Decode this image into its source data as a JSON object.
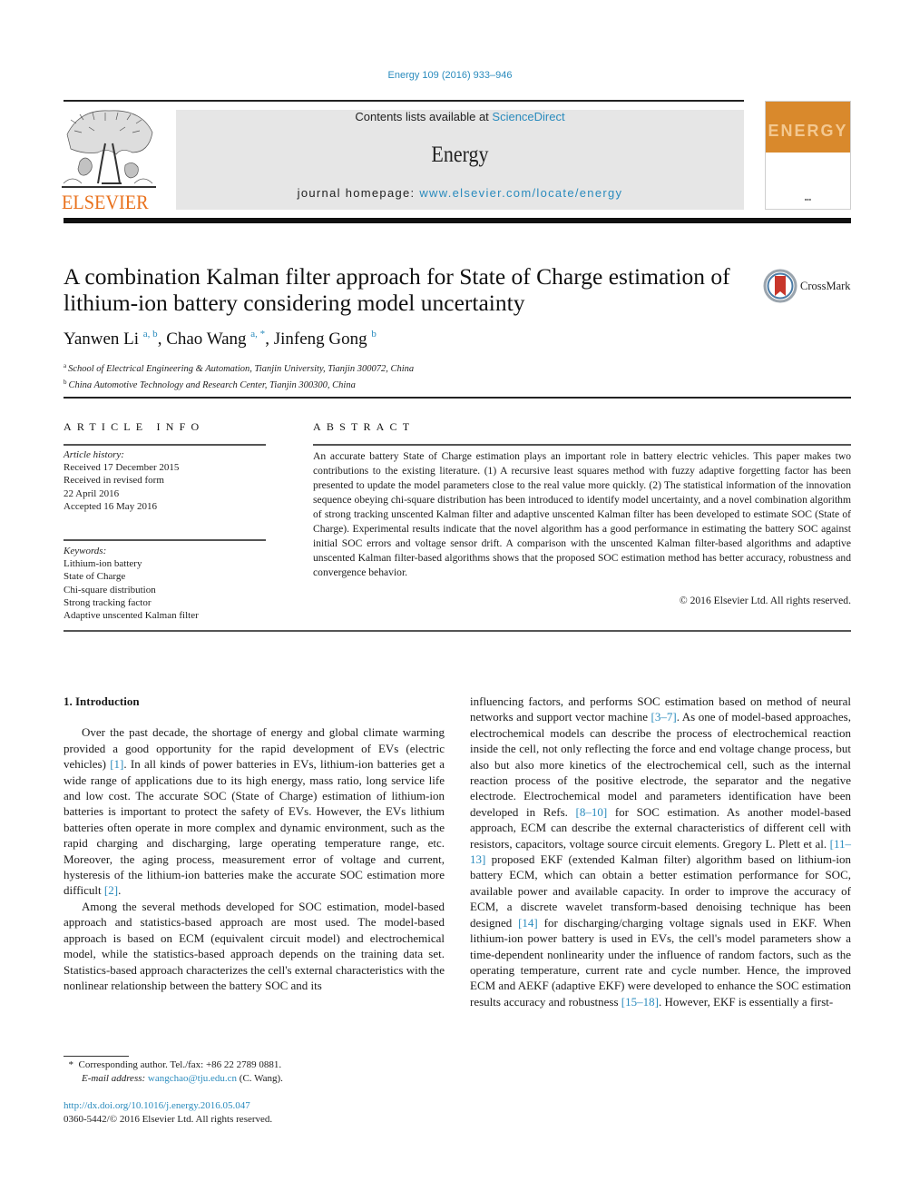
{
  "citation": "Energy 109 (2016) 933–946",
  "header": {
    "publisher_logo_text": "ELSEVIER",
    "contents_prefix": "Contents lists available at ",
    "contents_link": "ScienceDirect",
    "journal_name": "Energy",
    "homepage_prefix": "journal homepage: ",
    "homepage_link": "www.elsevier.com/locate/energy",
    "cover_word": "ENERGY",
    "colors": {
      "link": "#2a8bbd",
      "elsevier_orange": "#e9711c",
      "cover_orange": "#d9892c",
      "header_box": "#e6e6e6"
    }
  },
  "article": {
    "title": "A combination Kalman filter approach for State of Charge estimation of lithium-ion battery considering model uncertainty",
    "crossmark_label": "CrossMark",
    "authors": [
      {
        "name": "Yanwen Li",
        "sup": "a, b"
      },
      {
        "name": "Chao Wang",
        "sup": "a, *"
      },
      {
        "name": "Jinfeng Gong",
        "sup": "b"
      }
    ],
    "affiliations": [
      {
        "mark": "a",
        "text": "School of Electrical Engineering & Automation, Tianjin University, Tianjin 300072, China"
      },
      {
        "mark": "b",
        "text": "China Automotive Technology and Research Center, Tianjin 300300, China"
      }
    ]
  },
  "article_info": {
    "label": "ARTICLE INFO",
    "history_label": "Article history:",
    "history": [
      "Received 17 December 2015",
      "Received in revised form",
      "22 April 2016",
      "Accepted 16 May 2016"
    ],
    "keywords_label": "Keywords:",
    "keywords": [
      "Lithium-ion battery",
      "State of Charge",
      "Chi-square distribution",
      "Strong tracking factor",
      "Adaptive unscented Kalman filter"
    ]
  },
  "abstract": {
    "label": "ABSTRACT",
    "text": "An accurate battery State of Charge estimation plays an important role in battery electric vehicles. This paper makes two contributions to the existing literature. (1) A recursive least squares method with fuzzy adaptive forgetting factor has been presented to update the model parameters close to the real value more quickly. (2) The statistical information of the innovation sequence obeying chi-square distribution has been introduced to identify model uncertainty, and a novel combination algorithm of strong tracking unscented Kalman filter and adaptive unscented Kalman filter has been developed to estimate SOC (State of Charge). Experimental results indicate that the novel algorithm has a good performance in estimating the battery SOC against initial SOC errors and voltage sensor drift. A comparison with the unscented Kalman filter-based algorithms and adaptive unscented Kalman filter-based algorithms shows that the proposed SOC estimation method has better accuracy, robustness and convergence behavior.",
    "copyright": "© 2016 Elsevier Ltd. All rights reserved."
  },
  "body": {
    "section_heading": "1.  Introduction",
    "p1": {
      "a": "Over the past decade, the shortage of energy and global climate warming provided a good opportunity for the rapid development of EVs (electric vehicles) ",
      "ref1": "[1]",
      "b": ". In all kinds of power batteries in EVs, lithium-ion batteries get a wide range of applications due to its high energy, mass ratio, long service life and low cost. The accurate SOC (State of Charge) estimation of lithium-ion batteries is important to protect the safety of EVs. However, the EVs lithium batteries often operate in more complex and dynamic environment, such as the rapid charging and discharging, large operating temperature range, etc. Moreover, the aging process, measurement error of voltage and current, hysteresis of the lithium-ion batteries make the accurate SOC estimation more difficult ",
      "ref2": "[2]",
      "c": "."
    },
    "p2": {
      "a": "Among the several methods developed for SOC estimation, model-based approach and statistics-based approach are most used. The model-based approach is based on ECM (equivalent circuit model) and electrochemical model, while the statistics-based approach depends on the training data set. Statistics-based approach characterizes the cell's external characteristics with the nonlinear relationship between the battery SOC and its"
    },
    "p3": {
      "a": "influencing factors, and performs SOC estimation based on method of neural networks and support vector machine ",
      "ref1": "[3–7]",
      "b": ". As one of model-based approaches, electrochemical models can describe the process of electrochemical reaction inside the cell, not only reflecting the force and end voltage change process, but also but also more kinetics of the electrochemical cell, such as the internal reaction process of the positive electrode, the separator and the negative electrode. Electrochemical model and parameters identification have been developed in Refs. ",
      "ref2": "[8–10]",
      "c": " for SOC estimation. As another model-based approach, ECM can describe the external characteristics of different cell with resistors, capacitors, voltage source circuit elements. Gregory L. Plett et al. ",
      "ref3": "[11–13]",
      "d": " proposed EKF (extended Kalman filter) algorithm based on lithium-ion battery ECM, which can obtain a better estimation performance for SOC, available power and available capacity. In order to improve the accuracy of ECM, a discrete wavelet transform-based denoising technique has been designed ",
      "ref4": "[14]",
      "e": " for discharging/charging voltage signals used in EKF. When lithium-ion power battery is used in EVs, the cell's model parameters show a time-dependent nonlinearity under the influence of random factors, such as the operating temperature, current rate and cycle number. Hence, the improved ECM and AEKF (adaptive EKF) were developed to enhance the SOC estimation results accuracy and robustness ",
      "ref5": "[15–18]",
      "f": ". However, EKF is essentially a first-"
    }
  },
  "footnote": {
    "star": "*",
    "corresponding": "Corresponding author. Tel./fax: +86 22 2789 0881.",
    "email_label": "E-mail address: ",
    "email": "wangchao@tju.edu.cn",
    "email_suffix": " (C. Wang)."
  },
  "doi": {
    "url": "http://dx.doi.org/10.1016/j.energy.2016.05.047",
    "issn_line": "0360-5442/© 2016 Elsevier Ltd. All rights reserved."
  }
}
